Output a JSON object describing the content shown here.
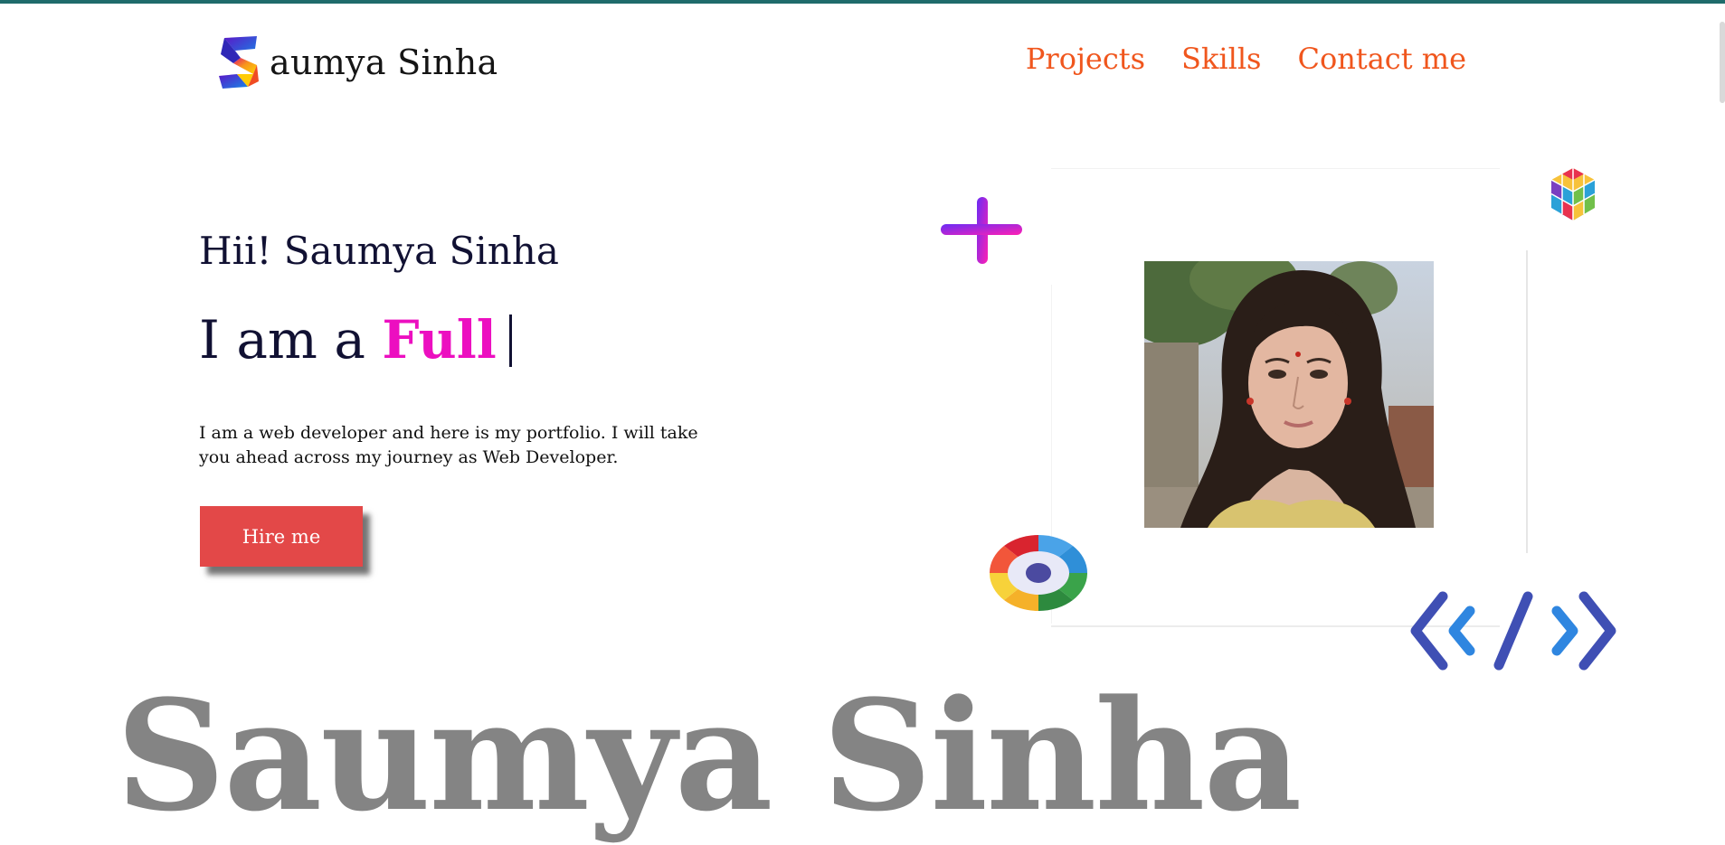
{
  "brand": {
    "text": "aumya Sinha",
    "logo_letter": "S"
  },
  "nav": [
    {
      "label": "Projects"
    },
    {
      "label": "Skills"
    },
    {
      "label": "Contact me"
    }
  ],
  "hero": {
    "greeting": "Hii! Saumya Sinha",
    "role_prefix": "I am a ",
    "role_highlight": "Full",
    "intro": "I am a web developer and here is my portfolio. I will take you ahead across my journey as Web Developer.",
    "cta_label": "Hire me",
    "big_name": "Saumya Sinha"
  },
  "colors": {
    "accent_nav": "#f0561d",
    "highlight": "#ec0fc0",
    "button": "#e34848",
    "top_border": "#1f6b6b"
  },
  "icons": [
    "plus-icon",
    "cube-icon",
    "eye-icon",
    "code-icon",
    "profile-photo"
  ]
}
